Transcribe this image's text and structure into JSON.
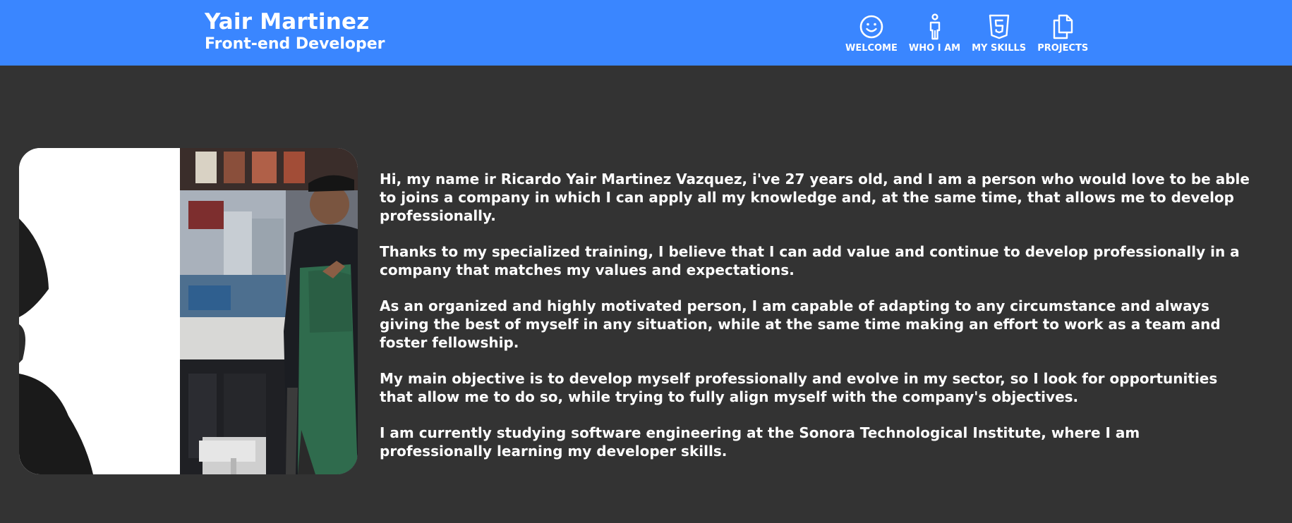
{
  "header": {
    "name": "Yair Martinez",
    "role": "Front-end Developer",
    "accent_color": "#3a86ff"
  },
  "nav": {
    "items": [
      {
        "label": "WELCOME",
        "icon": "smiley-icon"
      },
      {
        "label": "WHO I AM",
        "icon": "person-icon"
      },
      {
        "label": "MY SKILLS",
        "icon": "html5-icon"
      },
      {
        "label": "PROJECTS",
        "icon": "files-icon"
      }
    ]
  },
  "about": {
    "paragraphs": [
      "Hi, my name ir Ricardo Yair Martinez Vazquez, i've 27 years old, and I am a person who would love to be able to joins a company in which I can apply all my knowledge and, at the same time, that allows me to develop professionally.",
      "Thanks to my specialized training, I believe that I can add value and continue to develop professionally in a company that matches my values and expectations.",
      "As an organized and highly motivated person, I am capable of adapting to any circumstance and always giving the best of myself in any situation, while at the same time making an effort to work as a team and foster fellowship.",
      "My main objective is to develop myself professionally and evolve in my sector, so I look for opportunities that allow me to do so, while trying to fully align myself with the company's objectives.",
      "I am currently studying software engineering at the Sonora Technological Institute, where I am professionally learning my developer skills."
    ]
  },
  "colors": {
    "background": "#333333",
    "text": "#ffffff"
  }
}
